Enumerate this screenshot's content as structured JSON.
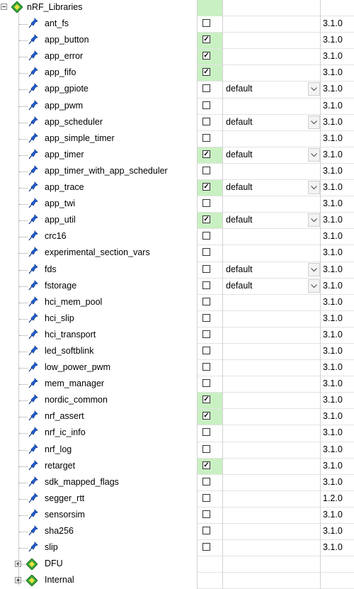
{
  "root": {
    "label": "nRF_Libraries",
    "expanded": true
  },
  "items": [
    {
      "name": "ant_fs",
      "checked": false,
      "variant": "",
      "version": "3.1.0"
    },
    {
      "name": "app_button",
      "checked": true,
      "variant": "",
      "version": "3.1.0"
    },
    {
      "name": "app_error",
      "checked": true,
      "variant": "",
      "version": "3.1.0"
    },
    {
      "name": "app_fifo",
      "checked": true,
      "variant": "",
      "version": "3.1.0"
    },
    {
      "name": "app_gpiote",
      "checked": false,
      "variant": "default",
      "version": "3.1.0"
    },
    {
      "name": "app_pwm",
      "checked": false,
      "variant": "",
      "version": "3.1.0"
    },
    {
      "name": "app_scheduler",
      "checked": false,
      "variant": "default",
      "version": "3.1.0"
    },
    {
      "name": "app_simple_timer",
      "checked": false,
      "variant": "",
      "version": "3.1.0"
    },
    {
      "name": "app_timer",
      "checked": true,
      "variant": "default",
      "version": "3.1.0"
    },
    {
      "name": "app_timer_with_app_scheduler",
      "checked": false,
      "variant": "",
      "version": "3.1.0"
    },
    {
      "name": "app_trace",
      "checked": true,
      "variant": "default",
      "version": "3.1.0"
    },
    {
      "name": "app_twi",
      "checked": false,
      "variant": "",
      "version": "3.1.0"
    },
    {
      "name": "app_util",
      "checked": true,
      "variant": "default",
      "version": "3.1.0"
    },
    {
      "name": "crc16",
      "checked": false,
      "variant": "",
      "version": "3.1.0"
    },
    {
      "name": "experimental_section_vars",
      "checked": false,
      "variant": "",
      "version": "3.1.0"
    },
    {
      "name": "fds",
      "checked": false,
      "variant": "default",
      "version": "3.1.0"
    },
    {
      "name": "fstorage",
      "checked": false,
      "variant": "default",
      "version": "3.1.0"
    },
    {
      "name": "hci_mem_pool",
      "checked": false,
      "variant": "",
      "version": "3.1.0"
    },
    {
      "name": "hci_slip",
      "checked": false,
      "variant": "",
      "version": "3.1.0"
    },
    {
      "name": "hci_transport",
      "checked": false,
      "variant": "",
      "version": "3.1.0"
    },
    {
      "name": "led_softblink",
      "checked": false,
      "variant": "",
      "version": "3.1.0"
    },
    {
      "name": "low_power_pwm",
      "checked": false,
      "variant": "",
      "version": "3.1.0"
    },
    {
      "name": "mem_manager",
      "checked": false,
      "variant": "",
      "version": "3.1.0"
    },
    {
      "name": "nordic_common",
      "checked": true,
      "variant": "",
      "version": "3.1.0"
    },
    {
      "name": "nrf_assert",
      "checked": true,
      "variant": "",
      "version": "3.1.0"
    },
    {
      "name": "nrf_ic_info",
      "checked": false,
      "variant": "",
      "version": "3.1.0"
    },
    {
      "name": "nrf_log",
      "checked": false,
      "variant": "",
      "version": "3.1.0"
    },
    {
      "name": "retarget",
      "checked": true,
      "variant": "",
      "version": "3.1.0"
    },
    {
      "name": "sdk_mapped_flags",
      "checked": false,
      "variant": "",
      "version": "3.1.0"
    },
    {
      "name": "segger_rtt",
      "checked": false,
      "variant": "",
      "version": "1.2.0"
    },
    {
      "name": "sensorsim",
      "checked": false,
      "variant": "",
      "version": "3.1.0"
    },
    {
      "name": "sha256",
      "checked": false,
      "variant": "",
      "version": "3.1.0"
    },
    {
      "name": "slip",
      "checked": false,
      "variant": "",
      "version": "3.1.0"
    }
  ],
  "groups": [
    {
      "label": "DFU",
      "expanded": false
    },
    {
      "label": "Internal",
      "expanded": false
    }
  ],
  "icons": {
    "root": "diamond-component-icon",
    "item": "blue-pin-icon",
    "group": "diamond-component-icon",
    "dropdown": "chevron-down-icon"
  },
  "colors": {
    "checked_cell": "#c9f0c2",
    "pin_blue": "#1f5fd6",
    "diamond_green": "#3aa83a",
    "diamond_yellow": "#f0e040"
  }
}
